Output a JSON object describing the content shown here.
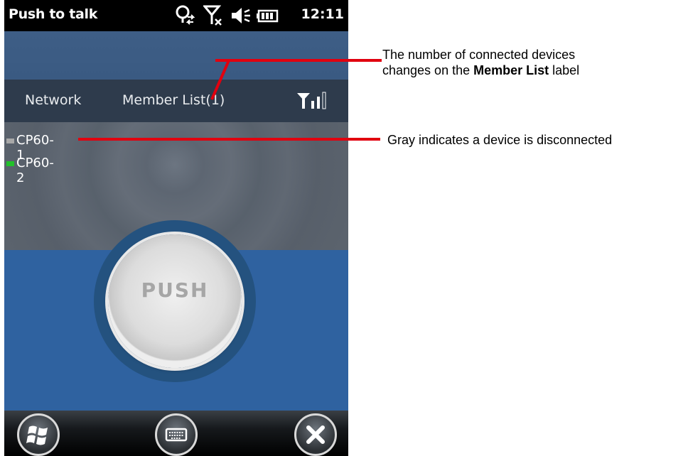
{
  "statusbar": {
    "title": "Push to talk",
    "time": "12:11",
    "icons": [
      "sync-icon",
      "no-signal-icon",
      "volume-mute-icon",
      "battery-icon"
    ]
  },
  "tabs": {
    "network": "Network",
    "members": "Member List(1)"
  },
  "members": [
    {
      "name": "CP60-1",
      "status": "disconnected",
      "color": "#a8a8a8"
    },
    {
      "name": "CP60-2",
      "status": "connected",
      "color": "#22c12a"
    }
  ],
  "push_button": {
    "label": "PUSH"
  },
  "bottombar": {
    "buttons": [
      "windows-start-icon",
      "keyboard-icon",
      "close-icon"
    ]
  },
  "annotations": {
    "member_count": {
      "line1": "The number of connected devices",
      "line2_before": "changes on the ",
      "line2_bold": "Member List",
      "line2_after": " label"
    },
    "gray_status": "Gray indicates a device is disconnected"
  },
  "colors": {
    "annotation_line": "#e1000f",
    "connected": "#22c12a",
    "disconnected": "#a8a8a8"
  }
}
